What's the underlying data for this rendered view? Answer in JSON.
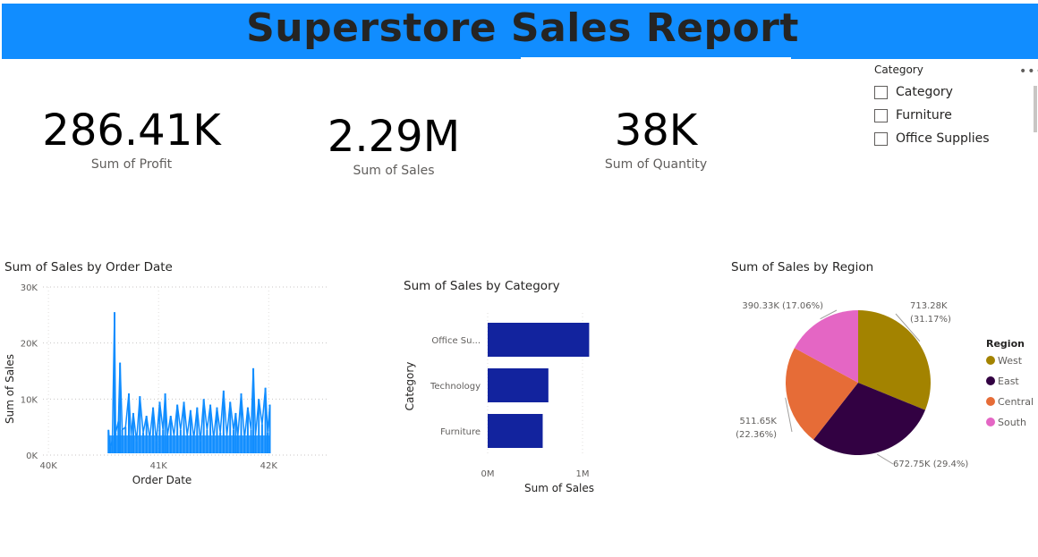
{
  "header": {
    "title": "Superstore Sales Report",
    "bg": "#118dff"
  },
  "kpis": [
    {
      "value": "286.41K",
      "label": "Sum of Profit"
    },
    {
      "value": "2.29M",
      "label": "Sum of Sales"
    },
    {
      "value": "38K",
      "label": "Sum of Quantity"
    }
  ],
  "slicer": {
    "title": "Category",
    "options": [
      "Category",
      "Furniture",
      "Office Supplies"
    ],
    "more_icon": "more-options-icon"
  },
  "charts": {
    "line": {
      "title": "Sum of Sales by Order Date"
    },
    "bar": {
      "title": "Sum of Sales by Category"
    },
    "pie": {
      "title": "Sum of Sales by Region"
    }
  },
  "chart_data": [
    {
      "type": "line",
      "title": "Sum of Sales by Order Date",
      "xlabel": "Order Date",
      "ylabel": "Sum of Sales",
      "x_ticks": [
        "40K",
        "41K",
        "42K"
      ],
      "y_ticks": [
        "0K",
        "10K",
        "20K",
        "30K"
      ],
      "xlim": [
        39950,
        42550
      ],
      "ylim": [
        0,
        30000
      ],
      "grid": true,
      "color": "#118dff",
      "series": [
        {
          "x": [
            40545,
            40560,
            40580,
            40600,
            40610,
            40635,
            40650,
            40670,
            40700,
            40730,
            40750,
            40770,
            40800,
            40830,
            40860,
            40890,
            40920,
            40950,
            40980,
            41010,
            41040,
            41060,
            41080,
            41110,
            41140,
            41170,
            41200,
            41230,
            41260,
            41290,
            41320,
            41350,
            41380,
            41410,
            41440,
            41470,
            41500,
            41530,
            41560,
            41590,
            41620,
            41650,
            41680,
            41700,
            41720,
            41750,
            41780,
            41810,
            41840,
            41860,
            41880,
            41910,
            41940,
            41970,
            41990,
            42010
          ],
          "y": [
            4500,
            1500,
            2500,
            25500,
            4000,
            6000,
            16500,
            4500,
            5000,
            11000,
            3500,
            7500,
            2500,
            10500,
            4000,
            7000,
            3000,
            8500,
            2500,
            9500,
            4500,
            11000,
            3500,
            7000,
            3500,
            9000,
            4500,
            9500,
            3500,
            8000,
            3000,
            8500,
            2500,
            10000,
            4500,
            9000,
            3000,
            8500,
            4000,
            11500,
            3500,
            9500,
            4500,
            7500,
            3500,
            11000,
            3000,
            8500,
            4500,
            15500,
            3500,
            10000,
            5500,
            12000,
            4000,
            9000
          ]
        }
      ]
    },
    {
      "type": "bar",
      "orientation": "horizontal",
      "title": "Sum of Sales by Category",
      "xlabel": "Sum of Sales",
      "ylabel": "Category",
      "categories": [
        "Office Su...",
        "Technology",
        "Furniture"
      ],
      "values": [
        1070000,
        640000,
        580000
      ],
      "x_ticks": [
        "0M",
        "1M"
      ],
      "xlim": [
        0,
        1000000
      ],
      "color": "#12239e"
    },
    {
      "type": "pie",
      "title": "Sum of Sales by Region",
      "legend_title": "Region",
      "legend_position": "right",
      "slices": [
        {
          "name": "West",
          "value": 713280,
          "label_value": "713.28K",
          "label_pct": "(31.17%)",
          "color": "#a38300"
        },
        {
          "name": "East",
          "value": 672750,
          "label_value": "672.75K",
          "label_pct": "(29.4%)",
          "color": "#320142"
        },
        {
          "name": "Central",
          "value": 511650,
          "label_value": "511.65K",
          "label_pct": "(22.36%)",
          "color": "#e66c37"
        },
        {
          "name": "South",
          "value": 390330,
          "label_value": "390.33K",
          "label_pct": "(17.06%)",
          "color": "#e466c4"
        }
      ]
    }
  ]
}
